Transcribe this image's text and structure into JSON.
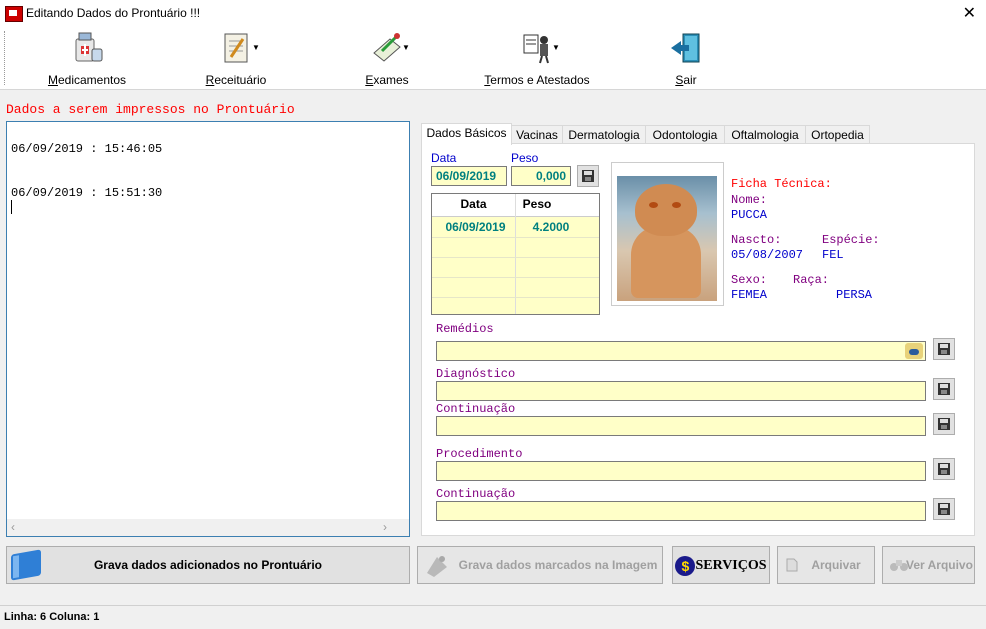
{
  "window": {
    "title": "Editando Dados do Prontuário !!!",
    "close": "✕"
  },
  "toolbar": {
    "items": [
      {
        "label": "Medicamentos",
        "accel": "M",
        "rest": "edicamentos"
      },
      {
        "label": "Receituário",
        "accel": "R",
        "rest": "eceituário"
      },
      {
        "label": "Exames",
        "accel": "E",
        "rest": "xames"
      },
      {
        "label": "Termos e Atestados",
        "accel": "T",
        "rest": "ermos e Atestados"
      },
      {
        "label": "Sair",
        "accel": "S",
        "rest": "air"
      }
    ]
  },
  "memo": {
    "header": "Dados a serem impressos no Prontuário",
    "lines": [
      "06/09/2019 : 15:46:05",
      "06/09/2019 : 15:51:30"
    ]
  },
  "tabs": [
    "Dados Básicos",
    "Vacinas",
    "Dermatologia",
    "Odontologia",
    "Oftalmologia",
    "Ortopedia"
  ],
  "basic": {
    "data_label": "Data",
    "peso_label": "Peso",
    "data_value": "06/09/2019",
    "peso_value": "0,000",
    "grid_headers": [
      "Data",
      "Peso"
    ],
    "grid_rows": [
      [
        "06/09/2019",
        "4.2000"
      ]
    ]
  },
  "ficha": {
    "title": "Ficha Técnica:",
    "nome_label": "Nome:",
    "nome": "PUCCA",
    "nascto_label": "Nascto:",
    "nascto": "05/08/2007",
    "especie_label": "Espécie:",
    "especie": "FEL",
    "sexo_label": "Sexo:",
    "sexo": "FEMEA",
    "raca_label": "Raça:",
    "raca": "PERSA"
  },
  "fields": {
    "remedios": "Remédios",
    "diagnostico": "Diagnóstico",
    "continuacao1": "Continuação",
    "procedimento": "Procedimento",
    "continuacao2": "Continuação"
  },
  "buttons": {
    "grava": "Grava dados adicionados no Prontuário",
    "grava_imagem": "Grava dados marcados na Imagem",
    "servicos": "SERVIÇOS",
    "arquivar": "Arquivar",
    "ver_arquivo": "Ver Arquivo"
  },
  "status": {
    "text": "Linha: 6  Coluna: 1"
  }
}
